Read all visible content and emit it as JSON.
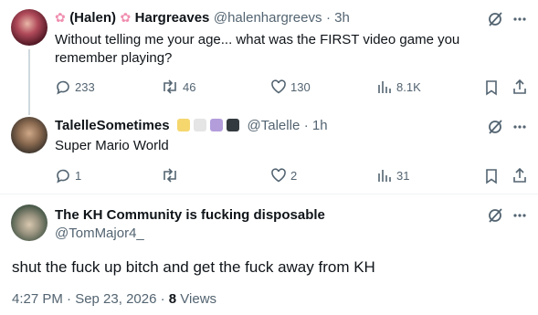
{
  "tweet1": {
    "name_prefix": "(Halen)",
    "name_suffix": "Hargreaves",
    "handle": "@halenhargreevs",
    "time": "· 3h",
    "text": "Without telling me your age... what was the FIRST video game you remember playing?",
    "replies": "233",
    "retweets": "46",
    "likes": "130",
    "views": "8.1K"
  },
  "tweet2": {
    "name": "TalelleSometimes",
    "handle": "@Talelle",
    "time": "· 1h",
    "text": "Super Mario World",
    "replies": "1",
    "retweets": "",
    "likes": "2",
    "views": "31",
    "chip_colors": [
      "#f5d76e",
      "#e5e5e5",
      "#b39ddb",
      "#333a3f"
    ]
  },
  "tweet3": {
    "name": "The KH Community is fucking disposable",
    "handle": "@TomMajor4_",
    "text": "shut the fuck up bitch and get the fuck away from KH",
    "timestamp": "4:27 PM · Sep 23, 2026 ·",
    "views_count": "8",
    "views_label": "Views"
  },
  "icons": {
    "more": "more-icon",
    "grok": "grok-icon",
    "reply": "reply-icon",
    "retweet": "retweet-icon",
    "like": "like-icon",
    "views": "views-icon",
    "bookmark": "bookmark-icon",
    "share": "share-icon",
    "flower": "cherry-blossom-icon"
  },
  "colors": {
    "text": "#0f1419",
    "secondary": "#536471",
    "divider": "#eff3f4",
    "thread": "#cfd9de"
  }
}
